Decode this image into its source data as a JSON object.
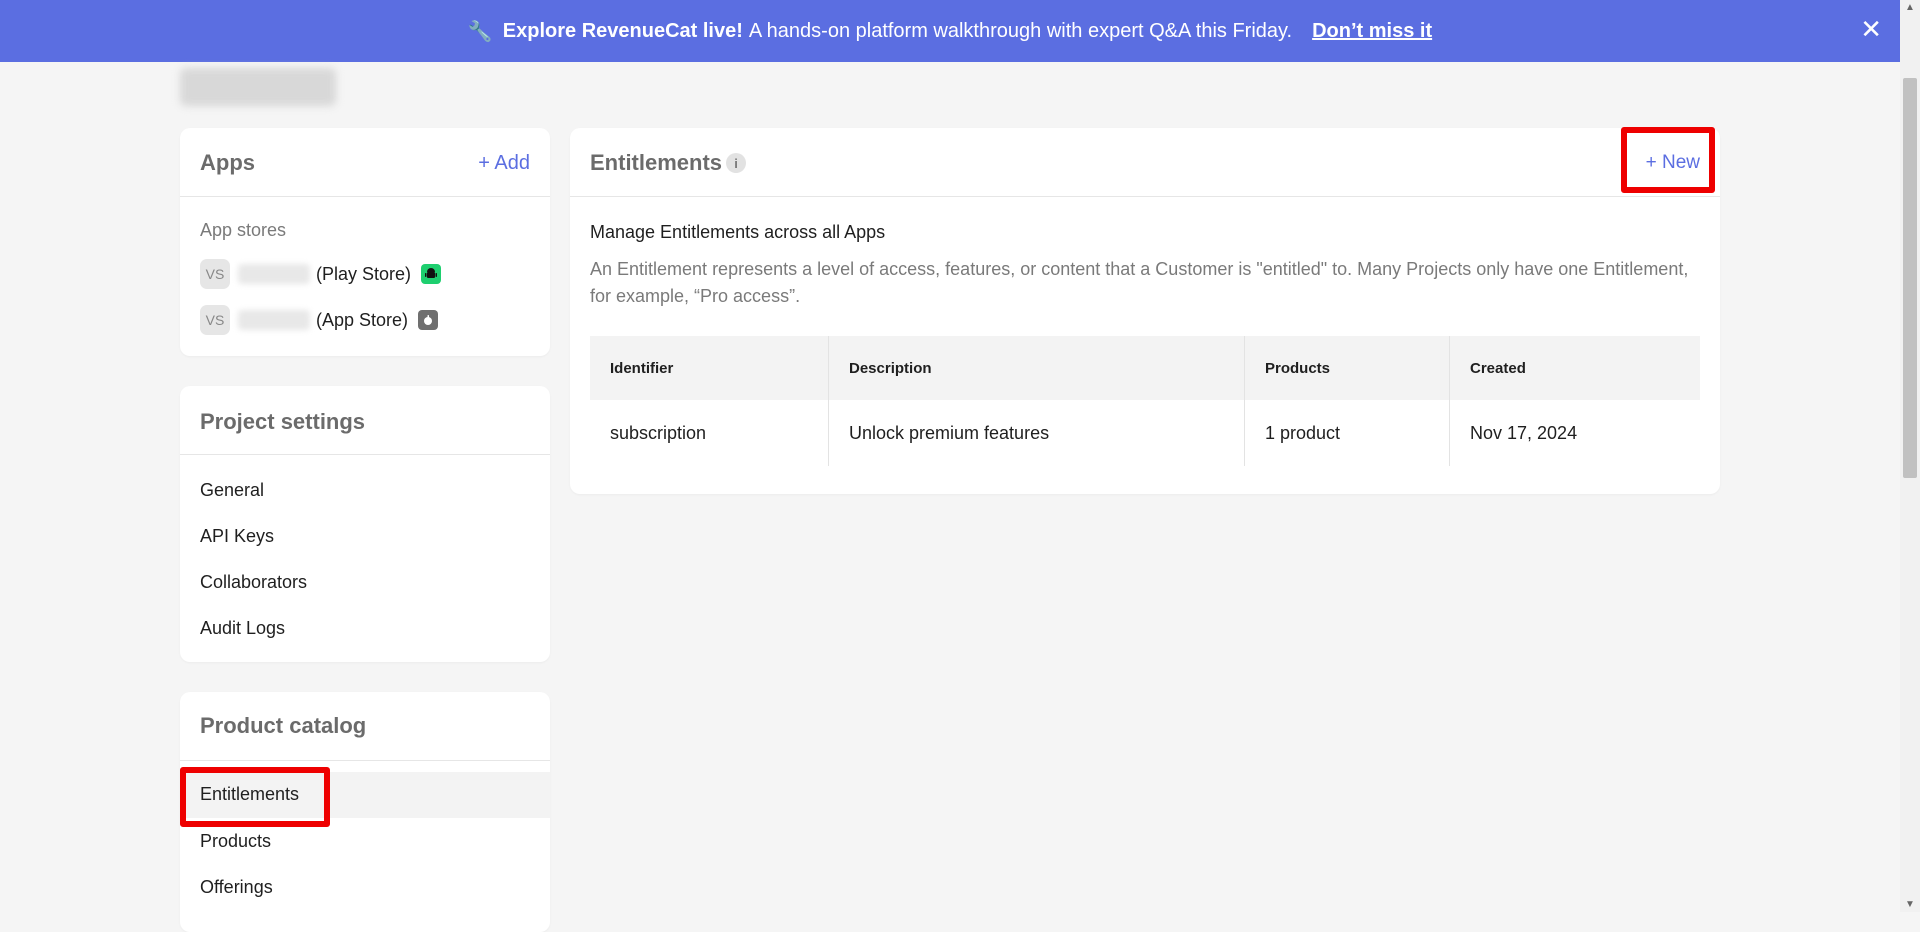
{
  "banner": {
    "icon": "wrench-icon",
    "bold_text": "Explore RevenueCat live!",
    "text": "A hands-on platform walkthrough with expert Q&A this Friday.",
    "cta": "Don’t miss it",
    "close": "✕",
    "color": "#5b6ee1"
  },
  "apps": {
    "title": "Apps",
    "add_label": "+ Add",
    "section_label": "App stores",
    "items": [
      {
        "avatar": "VS",
        "store": "(Play Store)",
        "icon": "android-icon",
        "badge_color": "#1ecf6f"
      },
      {
        "avatar": "VS",
        "store": "(App Store)",
        "icon": "apple-icon",
        "badge_color": "#6f6f6f"
      }
    ]
  },
  "project_settings": {
    "title": "Project settings",
    "items": [
      "General",
      "API Keys",
      "Collaborators",
      "Audit Logs"
    ]
  },
  "product_catalog": {
    "title": "Product catalog",
    "items": [
      "Entitlements",
      "Products",
      "Offerings"
    ],
    "active": "Entitlements"
  },
  "entitlements": {
    "title": "Entitlements",
    "info_icon": "i",
    "new_label": "+ New",
    "heading": "Manage Entitlements across all Apps",
    "description": "An Entitlement represents a level of access, features, or content that a Customer is \"entitled\" to. Many Projects only have one Entitlement, for example, “Pro access”.",
    "table": {
      "headers": [
        "Identifier",
        "Description",
        "Products",
        "Created"
      ],
      "rows": [
        [
          "subscription",
          "Unlock premium features",
          "1 product",
          "Nov 17, 2024"
        ]
      ]
    }
  },
  "accent_color": "#5b6ee1",
  "highlight_color": "#ee0000"
}
